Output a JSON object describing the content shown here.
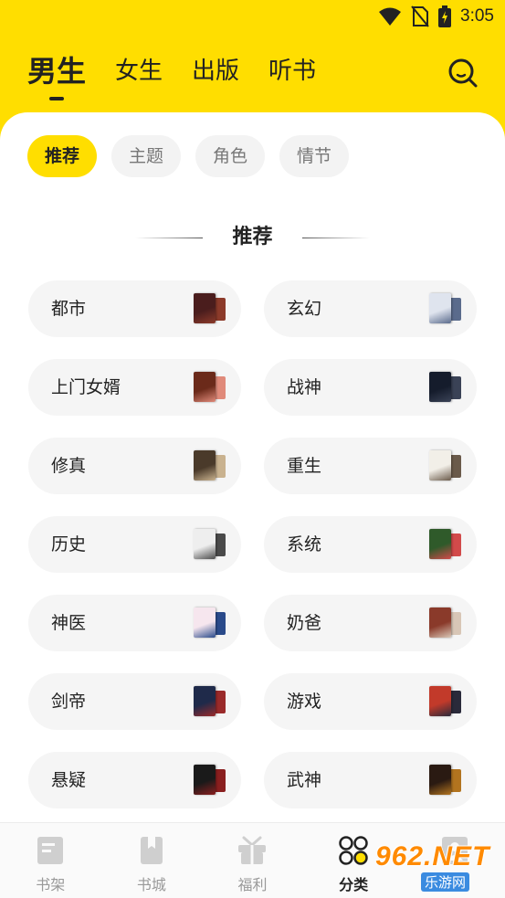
{
  "status_bar": {
    "time": "3:05",
    "icons": [
      "wifi-icon",
      "no-sim-icon",
      "battery-charging-icon"
    ]
  },
  "top_tabs": [
    {
      "label": "男生",
      "active": true
    },
    {
      "label": "女生",
      "active": false
    },
    {
      "label": "出版",
      "active": false
    },
    {
      "label": "听书",
      "active": false
    }
  ],
  "search": {
    "icon": "search-icon"
  },
  "chips": [
    {
      "label": "推荐",
      "active": true
    },
    {
      "label": "主题",
      "active": false
    },
    {
      "label": "角色",
      "active": false
    },
    {
      "label": "情节",
      "active": false
    }
  ],
  "section": {
    "title": "推荐"
  },
  "categories": [
    {
      "label": "都市",
      "covers": [
        "#4a1d1d",
        "#8c3a2a"
      ]
    },
    {
      "label": "玄幻",
      "covers": [
        "#dfe4ee",
        "#5a6b8c"
      ]
    },
    {
      "label": "上门女婿",
      "covers": [
        "#6b2a1a",
        "#e08a7a"
      ]
    },
    {
      "label": "战神",
      "covers": [
        "#151c2c",
        "#3a4256"
      ]
    },
    {
      "label": "修真",
      "covers": [
        "#4a3a2a",
        "#c9b28f"
      ]
    },
    {
      "label": "重生",
      "covers": [
        "#f2efe8",
        "#6a5a4a"
      ]
    },
    {
      "label": "历史",
      "covers": [
        "#eeeeee",
        "#4a4a4a"
      ]
    },
    {
      "label": "系统",
      "covers": [
        "#2f5a2a",
        "#d24a4a"
      ]
    },
    {
      "label": "神医",
      "covers": [
        "#f6e6ee",
        "#2a4a8a"
      ]
    },
    {
      "label": "奶爸",
      "covers": [
        "#8a3a2a",
        "#d8c6b6"
      ]
    },
    {
      "label": "剑帝",
      "covers": [
        "#1f2a4a",
        "#9a2a2a"
      ]
    },
    {
      "label": "游戏",
      "covers": [
        "#c23a2a",
        "#2a2a3a"
      ]
    },
    {
      "label": "悬疑",
      "covers": [
        "#1a1a1a",
        "#8a1f1f"
      ]
    },
    {
      "label": "武神",
      "covers": [
        "#2a1a12",
        "#b2741f"
      ]
    }
  ],
  "bottom_nav": [
    {
      "label": "书架",
      "icon": "bookshelf-icon",
      "active": false
    },
    {
      "label": "书城",
      "icon": "bookstore-icon",
      "active": false
    },
    {
      "label": "福利",
      "icon": "gift-icon",
      "active": false
    },
    {
      "label": "分类",
      "icon": "category-icon",
      "active": true
    },
    {
      "label": "",
      "icon": "profile-icon",
      "active": false
    }
  ],
  "watermark": {
    "main": "962.NET",
    "sub": "乐游网"
  },
  "colors": {
    "accent": "#ffde00",
    "chip_bg": "#f3f3f3",
    "card_bg": "#f5f5f5",
    "nav_inactive": "#999999"
  }
}
